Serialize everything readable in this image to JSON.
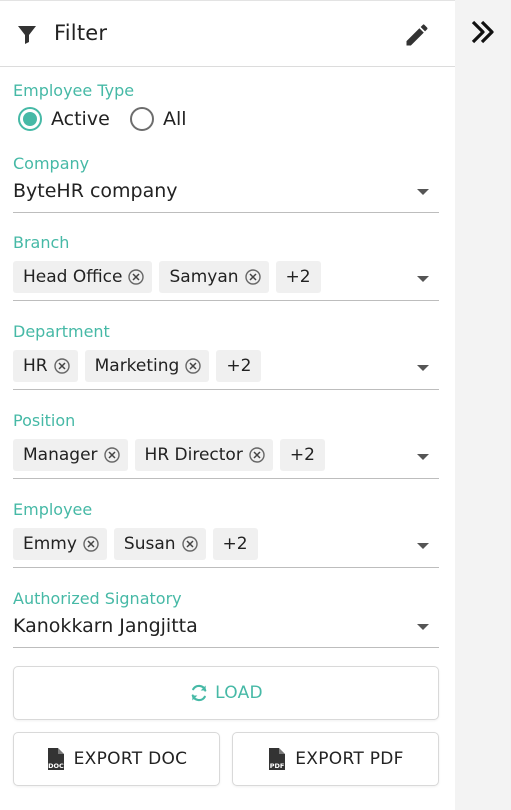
{
  "header": {
    "title": "Filter",
    "filter_icon": "filter-icon",
    "edit_icon": "pencil-icon"
  },
  "sidebar": {
    "collapse_icon": "double-chevron-right-icon"
  },
  "employee_type": {
    "label": "Employee Type",
    "options": [
      {
        "label": "Active",
        "selected": true
      },
      {
        "label": "All",
        "selected": false
      }
    ]
  },
  "company": {
    "label": "Company",
    "value": "ByteHR company"
  },
  "branch": {
    "label": "Branch",
    "chips": [
      "Head Office",
      "Samyan"
    ],
    "more": "+2"
  },
  "department": {
    "label": "Department",
    "chips": [
      "HR",
      "Marketing"
    ],
    "more": "+2"
  },
  "position": {
    "label": "Position",
    "chips": [
      "Manager",
      "HR Director"
    ],
    "more": "+2"
  },
  "employee": {
    "label": "Employee",
    "chips": [
      "Emmy",
      "Susan"
    ],
    "more": "+2"
  },
  "signatory": {
    "label": "Authorized Signatory",
    "value": "Kanokkarn Jangjitta"
  },
  "actions": {
    "load_label": "LOAD",
    "export_doc_label": "EXPORT DOC",
    "export_pdf_label": "EXPORT PDF",
    "doc_badge": "DOC",
    "pdf_badge": "PDF"
  },
  "colors": {
    "accent": "#46b9a6",
    "text": "#222222",
    "chip_bg": "#f0f0f0",
    "sidebar_bg": "#f3f3f3"
  }
}
